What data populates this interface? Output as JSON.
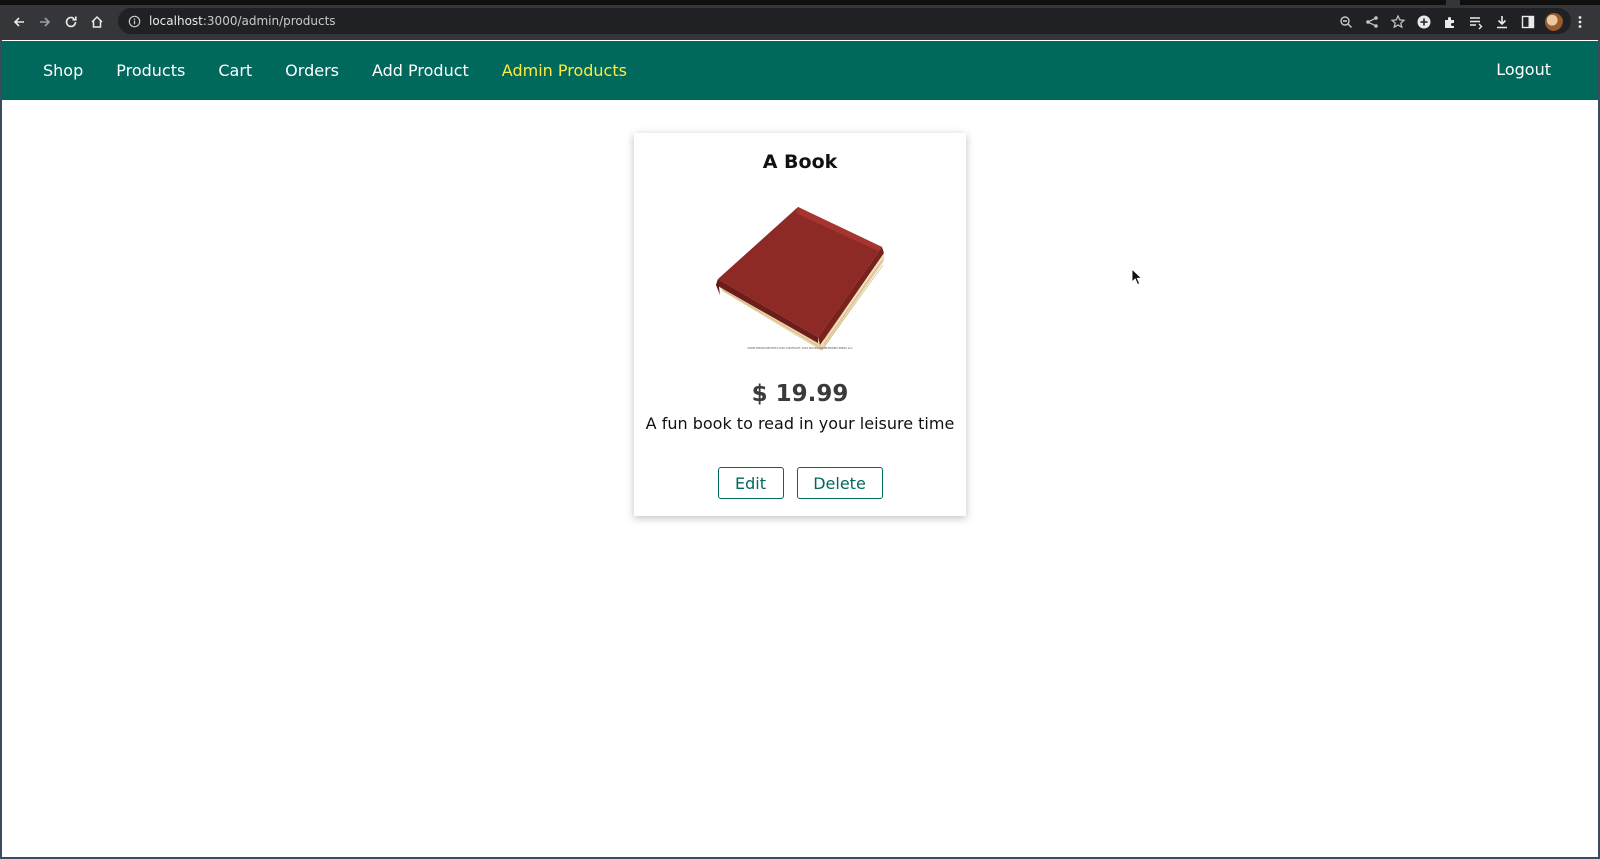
{
  "browser": {
    "url_host": "localhost",
    "url_path": ":3000/admin/products",
    "icons": [
      "back-icon",
      "forward-icon",
      "reload-icon",
      "home-icon",
      "info-icon",
      "zoom-icon",
      "share-icon",
      "star-icon",
      "extension-plus-icon",
      "puzzle-icon",
      "reading-list-icon",
      "download-icon",
      "sidepanel-icon",
      "avatar",
      "menu-icon"
    ]
  },
  "nav": {
    "items": [
      {
        "label": "Shop"
      },
      {
        "label": "Products"
      },
      {
        "label": "Cart"
      },
      {
        "label": "Orders"
      },
      {
        "label": "Add Product"
      },
      {
        "label": "Admin Products"
      }
    ],
    "logout_label": "Logout",
    "bg_color": "#00695c",
    "active_color": "#ffeb3b"
  },
  "product": {
    "title": "A Book",
    "price": "$ 19.99",
    "description": "A fun book to read in your leisure time",
    "edit_label": "Edit",
    "delete_label": "Delete",
    "image_caption": "WWW.TREASURECHEST.COM COPYRIGHT 2019 BOOKSANDMEMORIES PRESS LLC"
  }
}
